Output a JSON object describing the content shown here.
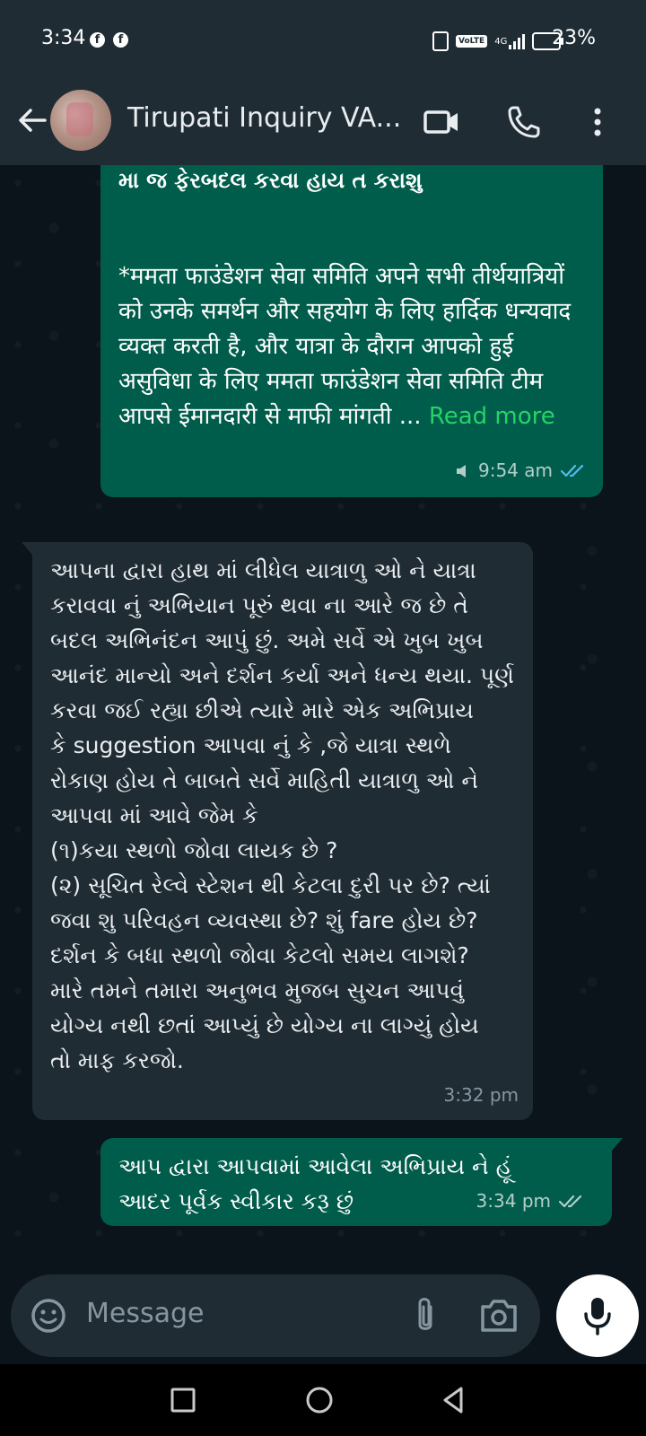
{
  "status_bar": {
    "time": "3:34",
    "icons": [
      "facebook-icon",
      "facebook-icon",
      "nfc-icon",
      "volte-icon",
      "signal-4g-icon",
      "battery-icon"
    ],
    "network": "4G",
    "volte_label": "VoLTE",
    "battery": "23%"
  },
  "header": {
    "title": "Tirupati Inquiry VA...",
    "icons": [
      "back-arrow-icon",
      "video-call-icon",
      "phone-call-icon",
      "more-vert-icon"
    ]
  },
  "messages": [
    {
      "direction": "outgoing",
      "cut_line": "મા જ ફેરબદલ કરવા હાય ત કરાશુ",
      "text": " *ममता फाउंडेशन सेवा समिति अपने सभी तीर्थयात्रियों को उनके समर्थन और सहयोग के लिए हार्दिक धन्यवाद व्यक्त करती है, और यात्रा के दौरान आपको हुई असुविधा के लिए ममता फाउंडेशन सेवा समिति टीम आपसे ईमानदारी से माफी मांगती ...",
      "read_more": "Read more",
      "time": "9:54 am",
      "status": "read"
    },
    {
      "direction": "incoming",
      "lines": [
        "આપના દ્વારા હાથ માં લીધેલ યાત્રાળુ ઓ ને યાત્રા",
        "કરાવવા નું અભિયાન પૂરું થવા ના આરે જ છે તે",
        "બદલ અભિનંદન આપું છું. અમે સર્વે એ ખુબ ખુબ",
        "આનંદ માન્યો અને દર્શન કર્યા અને ધન્ય થયા. પૂર્ણ",
        "કરવા જઈ રહ્યા છીએ ત્યારે મારે એક અભિપ્રાય",
        "કે suggestion આપવા નું કે ,જે યાત્રા સ્થળે",
        "રોકાણ હોય તે બાબતે સર્વે માહિતી યાત્રાળુ ઓ ને",
        "આપવા માં આવે જેમ કે",
        "(૧)કયા સ્થળો જોવા લાયક છે ?",
        "(૨) સૂચિત રેલ્વે સ્ટેશન થી કેટલા દુરી પર છે? ત્યાં",
        "જવા શુ પરિવહન વ્યવસ્થા છે? શું fare હોય છે?",
        "દર્શન કે બધા સ્થળો જોવા કેટલો સમય લાગશે?",
        " મારે તમને તમારા અનુભવ મુજબ સુચન આપવું",
        "યોગ્ય નથી છતાં આપ્યું છે યોગ્ય ના લાગ્યું હોય",
        "તો માફ કરજો."
      ],
      "time": "3:32 pm"
    },
    {
      "direction": "outgoing",
      "lines": [
        "આપ દ્વારા આપવામાં આવેલા અભિપ્રાય ને હૂં",
        "આદર પૂર્વક સ્વીકાર કરૂ છું"
      ],
      "time": "3:34 pm",
      "status": "delivered"
    }
  ],
  "input": {
    "placeholder": "Message",
    "icons": [
      "emoji-icon",
      "attach-icon",
      "camera-icon",
      "mic-icon"
    ]
  },
  "nav": {
    "icons": [
      "recents-icon",
      "home-icon",
      "back-icon"
    ]
  },
  "colors": {
    "outgoing_bubble": "#005c4b",
    "incoming_bubble": "#202c33",
    "accent_green": "#25d366",
    "read_tick": "#53bdeb",
    "header_bg": "#1f2c34"
  }
}
